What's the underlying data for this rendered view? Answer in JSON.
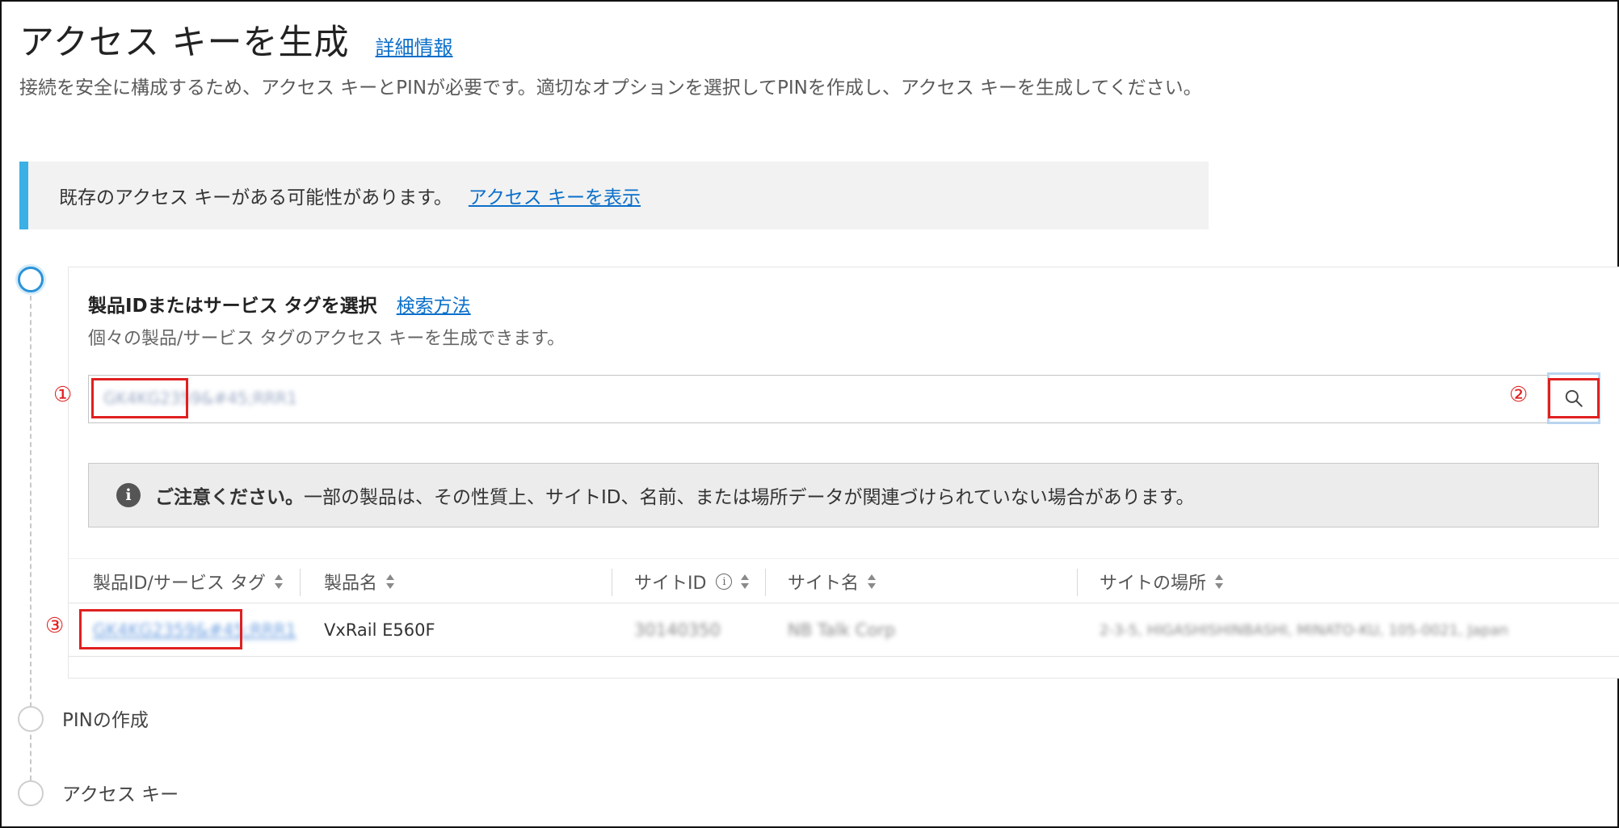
{
  "header": {
    "title": "アクセス キーを生成",
    "learn_more": "詳細情報"
  },
  "intro": "接続を安全に構成するため、アクセス キーとPINが必要です。適切なオプションを選択してPINを作成し、アクセス キーを生成してください。",
  "notice": {
    "text": "既存のアクセス キーがある可能性があります。",
    "link": "アクセス キーを表示"
  },
  "step1": {
    "title": "製品IDまたはサービス タグを選択",
    "help_link": "検索方法",
    "subtitle": "個々の製品/サービス タグのアクセス キーを生成できます。",
    "search_value": "GK4KG2359&#45;RRR1",
    "info_bold": "ご注意ください。",
    "info_text": "一部の製品は、その性質上、サイトID、名前、または場所データが関連づけられていない場合があります。",
    "table": {
      "columns": [
        "製品ID/サービス タグ",
        "製品名",
        "サイトID",
        "サイト名",
        "サイトの場所"
      ],
      "rows": [
        {
          "product_id": "GK4KG2359&#45;RRR1",
          "product_name": "VxRail E560F",
          "site_id": "30140350",
          "site_name": "NB Talk Corp",
          "site_location": "2-3-5, HIGASHISHINBASHI, MINATO-KU, 105-0021, Japan"
        }
      ]
    }
  },
  "steps": {
    "step2": "PINの作成",
    "step3": "アクセス キー"
  },
  "callouts": {
    "one": "①",
    "two": "②",
    "three": "③"
  },
  "colors": {
    "accent": "#3bb0e4",
    "link": "#0b6fc9",
    "callout": "#e02020"
  }
}
